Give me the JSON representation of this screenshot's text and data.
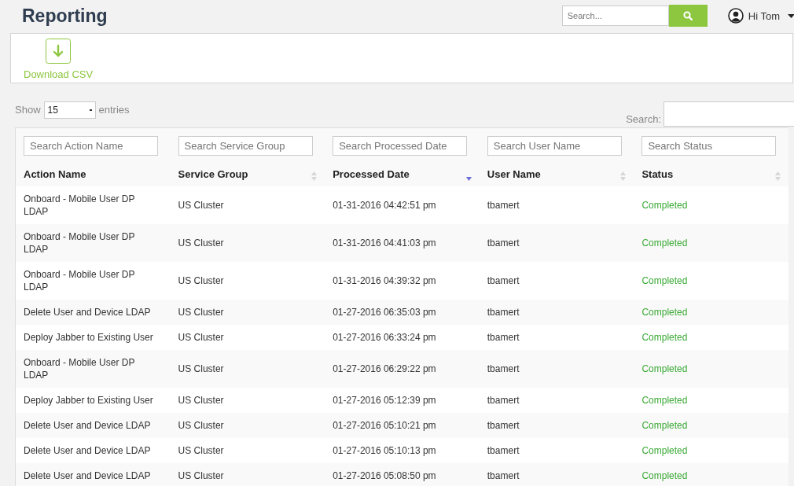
{
  "header": {
    "title": "Reporting",
    "search": {
      "placeholder": "Search..."
    },
    "user": {
      "greeting": "Hi Tom"
    }
  },
  "toolbar": {
    "actions": [
      {
        "label": "Download CSV"
      }
    ]
  },
  "table_controls": {
    "show_label": "Show",
    "page_size": "15",
    "entries_label": "entries",
    "search_label": "Search:"
  },
  "table": {
    "columns": [
      {
        "label": "Action Name",
        "filter_placeholder": "Search Action Name",
        "sortable": false
      },
      {
        "label": "Service Group",
        "filter_placeholder": "Search Service Group",
        "sortable": true,
        "sorted": false
      },
      {
        "label": "Processed Date",
        "filter_placeholder": "Search Processed Date",
        "sortable": true,
        "sorted": true
      },
      {
        "label": "User Name",
        "filter_placeholder": "Search User Name",
        "sortable": true,
        "sorted": false
      },
      {
        "label": "Status",
        "filter_placeholder": "Search Status",
        "sortable": true,
        "sorted": false
      }
    ],
    "rows": [
      [
        "Onboard - Mobile User DP LDAP",
        "US Cluster",
        "01-31-2016 04:42:51 pm",
        "tbamert",
        "Completed"
      ],
      [
        "Onboard - Mobile User DP LDAP",
        "US Cluster",
        "01-31-2016 04:41:03 pm",
        "tbamert",
        "Completed"
      ],
      [
        "Onboard - Mobile User DP LDAP",
        "US Cluster",
        "01-31-2016 04:39:32 pm",
        "tbamert",
        "Completed"
      ],
      [
        "Delete User and Device LDAP",
        "US Cluster",
        "01-27-2016 06:35:03 pm",
        "tbamert",
        "Completed"
      ],
      [
        "Deploy Jabber to Existing User",
        "US Cluster",
        "01-27-2016 06:33:24 pm",
        "tbamert",
        "Completed"
      ],
      [
        "Onboard - Mobile User DP LDAP",
        "US Cluster",
        "01-27-2016 06:29:22 pm",
        "tbamert",
        "Completed"
      ],
      [
        "Deploy Jabber to Existing User",
        "US Cluster",
        "01-27-2016 05:12:39 pm",
        "tbamert",
        "Completed"
      ],
      [
        "Delete User and Device LDAP",
        "US Cluster",
        "01-27-2016 05:10:21 pm",
        "tbamert",
        "Completed"
      ],
      [
        "Delete User and Device LDAP",
        "US Cluster",
        "01-27-2016 05:10:13 pm",
        "tbamert",
        "Completed"
      ],
      [
        "Delete User and Device LDAP",
        "US Cluster",
        "01-27-2016 05:08:50 pm",
        "tbamert",
        "Completed"
      ]
    ]
  }
}
